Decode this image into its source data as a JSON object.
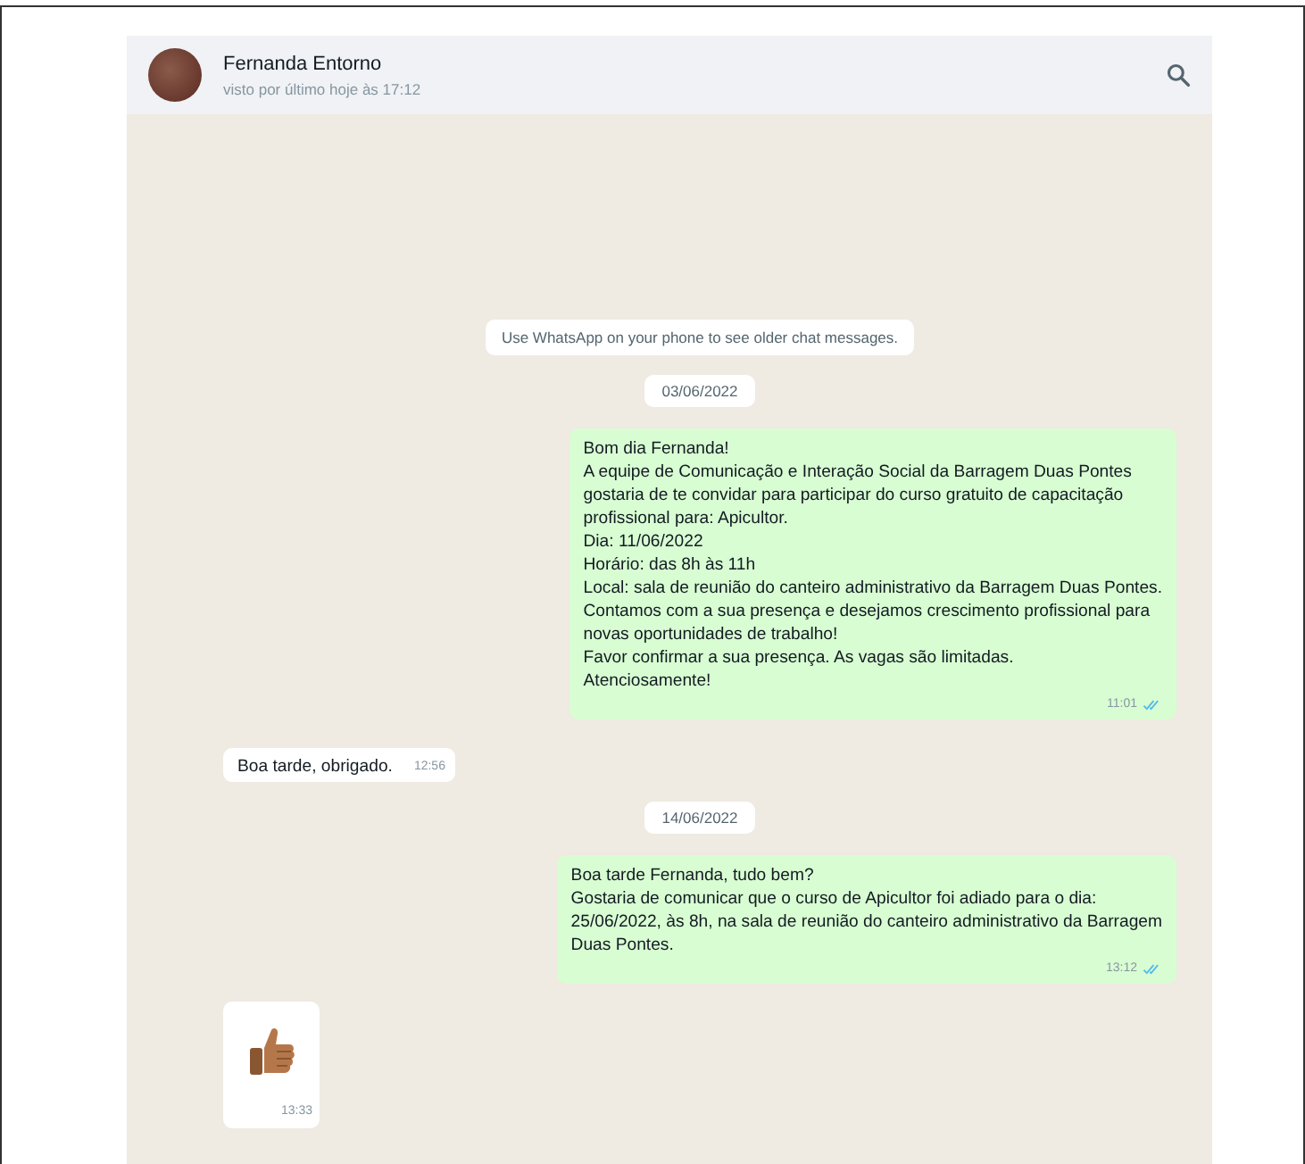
{
  "header": {
    "contact_name": "Fernanda Entorno",
    "status": "visto por último hoje às 17:12"
  },
  "messages": [
    {
      "kind": "notice",
      "lines": [
        "Use WhatsApp on your phone to see older chat messages."
      ]
    },
    {
      "kind": "date",
      "lines": [
        "03/06/2022"
      ]
    },
    {
      "kind": "outgoing",
      "lines": [
        "Bom dia Fernanda!",
        "A equipe de Comunicação e Interação Social da Barragem Duas Pontes",
        "gostaria de te convidar para participar do curso gratuito de capacitação",
        "profissional para: Apicultor.",
        "Dia: 11/06/2022",
        "Horário: das 8h às 11h",
        "Local: sala de reunião do canteiro administrativo da Barragem Duas Pontes.",
        "Contamos com a sua presença e desejamos crescimento profissional para",
        "novas oportunidades de trabalho!",
        "Favor confirmar a sua presença. As vagas são limitadas.",
        "Atenciosamente!"
      ],
      "time": "11:01"
    },
    {
      "kind": "incoming",
      "lines": [
        "Boa tarde, obrigado."
      ],
      "time": "12:56"
    },
    {
      "kind": "date",
      "lines": [
        "14/06/2022"
      ]
    },
    {
      "kind": "outgoing",
      "lines": [
        "Boa tarde Fernanda, tudo bem?",
        "Gostaria de comunicar que o curso de Apicultor foi adiado para o dia:",
        "25/06/2022, às 8h, na sala de reunião do canteiro administrativo da Barragem",
        "Duas Pontes."
      ],
      "time": "13:12"
    },
    {
      "kind": "sticker",
      "time": "13:33"
    }
  ]
}
